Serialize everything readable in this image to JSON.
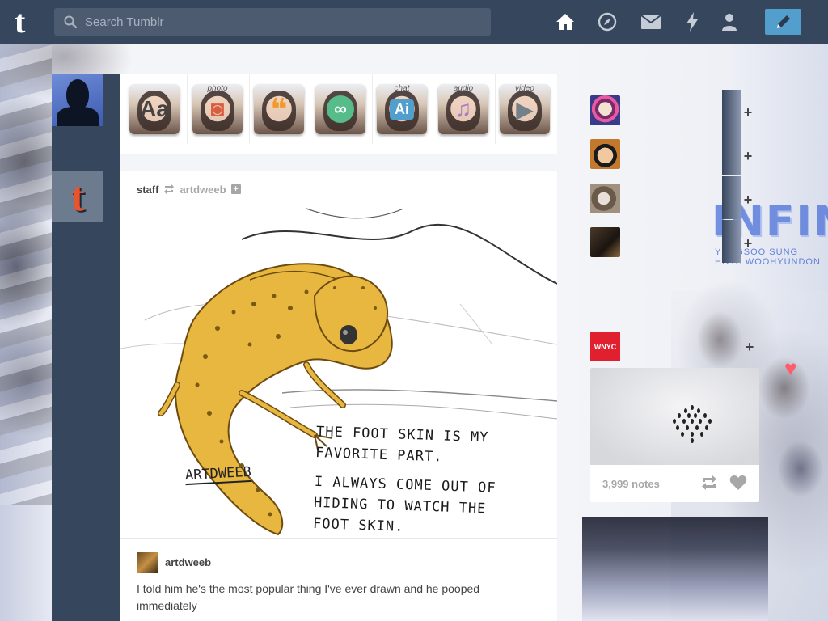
{
  "header": {
    "logo": "t",
    "search_placeholder": "Search Tumblr",
    "nav": [
      "home-icon",
      "explore-icon",
      "inbox-icon",
      "activity-icon",
      "account-icon"
    ],
    "compose_icon": "pencil-icon",
    "bg_color": "#36465d",
    "accent_color": "#529ecc"
  },
  "post_types": [
    {
      "name": "text",
      "symbol": "Aa",
      "caption": "",
      "color": "#444444"
    },
    {
      "name": "photo",
      "symbol": "◙",
      "caption": "photo",
      "color": "#d95e40"
    },
    {
      "name": "quote",
      "symbol": "❝",
      "caption": "",
      "color": "#f2992e"
    },
    {
      "name": "link",
      "symbol": "∞",
      "caption": "",
      "color": "#56bc8a"
    },
    {
      "name": "chat",
      "symbol": "Ai",
      "caption": "chat",
      "color": "#529ecc"
    },
    {
      "name": "audio",
      "symbol": "♫",
      "caption": "audio",
      "color": "#a77dc2"
    },
    {
      "name": "video",
      "symbol": "▶",
      "caption": "video",
      "color": "#748089"
    }
  ],
  "left_avatars": {
    "staff_letter": "t"
  },
  "post": {
    "author": "staff",
    "source": "artdweeb",
    "follow_symbol": "+",
    "comic": {
      "lines": [
        "THE FOOT SKIN IS MY",
        "FAVORITE PART.",
        "",
        "I ALWAYS COME OUT OF",
        "HIDING TO WATCH THE",
        "FOOT SKIN."
      ],
      "signature": "ARTDWEEB"
    },
    "comment": {
      "name": "artdweeb",
      "text": "I told him he's the most popular thing I've ever drawn and he pooped immediately"
    }
  },
  "sidebar": {
    "follow_symbol": "+",
    "recommended": [
      {
        "name": "rec-1",
        "color": "#b04a8a"
      },
      {
        "name": "rec-2",
        "color": "#c4782c"
      },
      {
        "name": "rec-3",
        "color": "#8b7a6a"
      },
      {
        "name": "rec-4",
        "color": "#3a3a3a"
      }
    ],
    "radar": {
      "avatar_text": "WNYC",
      "notes": "3,999 notes"
    }
  },
  "background_text": {
    "big": "INFIN",
    "sub_1": "YUNGSOO SUNG",
    "sub_2": "HOYA WOOHYUNDON"
  }
}
